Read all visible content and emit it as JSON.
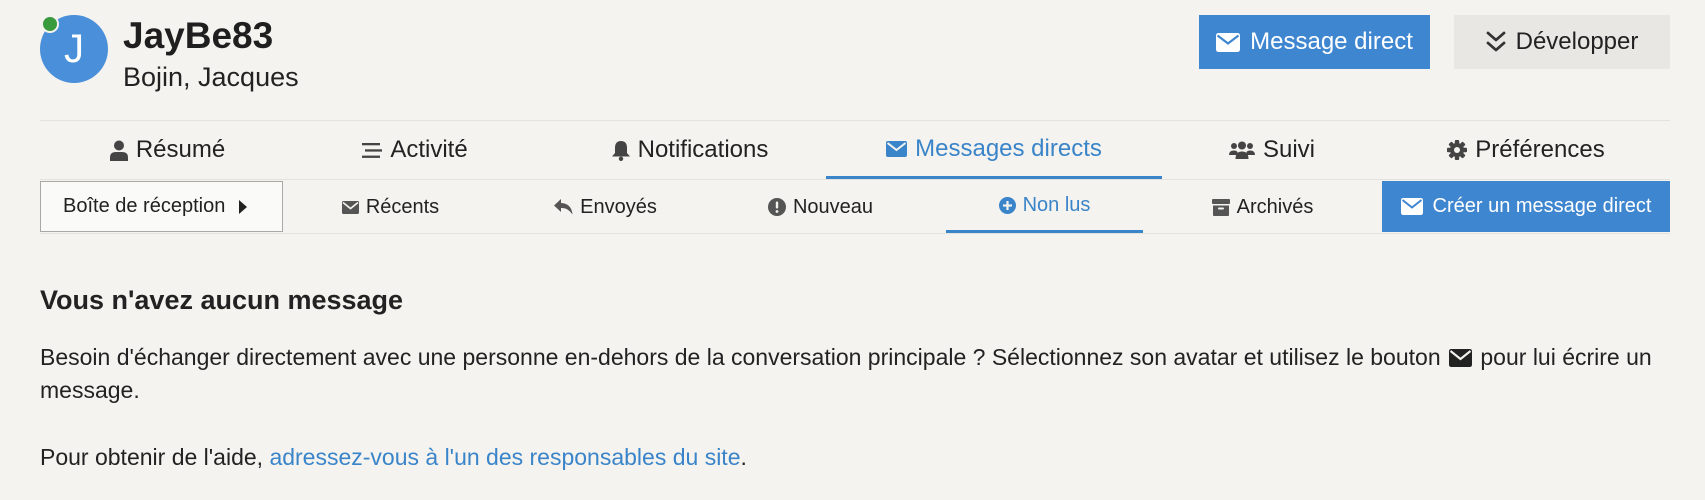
{
  "user": {
    "avatar_letter": "J",
    "username": "JayBe83",
    "full_name": "Bojin, Jacques",
    "presence": "online",
    "avatar_color": "#4a8fd9",
    "presence_color": "#3a9a3e"
  },
  "header_actions": {
    "direct_message_label": "Message direct",
    "direct_message_icon": "envelope-icon",
    "expand_label": "Développer",
    "expand_icon": "double-chevron-down-icon"
  },
  "tabs": [
    {
      "label": "Résumé",
      "icon": "user-icon",
      "active": false
    },
    {
      "label": "Activité",
      "icon": "stream-icon",
      "active": false
    },
    {
      "label": "Notifications",
      "icon": "bell-icon",
      "active": false
    },
    {
      "label": "Messages directs",
      "icon": "envelope-icon",
      "active": true
    },
    {
      "label": "Suivi",
      "icon": "users-icon",
      "active": false
    },
    {
      "label": "Préférences",
      "icon": "gear-icon",
      "active": false
    }
  ],
  "messages_nav": {
    "mailbox_selector": "Boîte de réception",
    "filters": [
      {
        "label": "Récents",
        "icon": "envelope-icon",
        "active": false
      },
      {
        "label": "Envoyés",
        "icon": "reply-icon",
        "active": false
      },
      {
        "label": "Nouveau",
        "icon": "exclamation-circle-icon",
        "active": false
      },
      {
        "label": "Non lus",
        "icon": "plus-circle-icon",
        "active": true
      },
      {
        "label": "Archivés",
        "icon": "archive-icon",
        "active": false
      }
    ],
    "compose_label": "Créer un message direct"
  },
  "empty_state": {
    "title": "Vous n'avez aucun message",
    "text_before_icon": "Besoin d'échanger directement avec une personne en-dehors de la conversation principale ? Sélectionnez son avatar et utilisez le bouton",
    "text_after_icon": "pour lui écrire un message.",
    "inline_icon": "envelope-icon",
    "help_prefix": "Pour obtenir de l'aide, ",
    "help_link": "adressez-vous à l'un des responsables du site",
    "help_suffix": "."
  },
  "colors": {
    "accent": "#3a84c9",
    "primary_button": "#3f86d0",
    "background": "#f4f3ef",
    "secondary_button": "#e8e7e3"
  }
}
